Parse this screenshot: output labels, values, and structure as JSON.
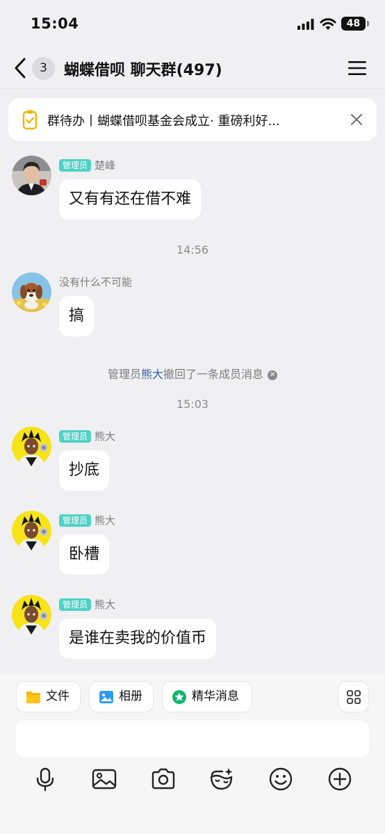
{
  "status_bar": {
    "time": "15:04",
    "battery": "48"
  },
  "header": {
    "unread_count": "3",
    "title": "蝴蝶借呗 聊天群(497)"
  },
  "todo_banner": {
    "text": "群待办丨蝴蝶借呗基金会成立·  重磅利好..."
  },
  "messages": [
    {
      "role_tag": "管理员",
      "sender": "楚峰",
      "text": "又有有还在借不难"
    },
    {
      "timestamp": "14:56"
    },
    {
      "sender": "没有什么不可能",
      "text": "搞"
    },
    {
      "system_prefix": "管理员",
      "system_name": "熊大",
      "system_suffix": "撤回了一条成员消息"
    },
    {
      "timestamp": "15:03"
    },
    {
      "role_tag": "管理员",
      "sender": "熊大",
      "text": "抄底"
    },
    {
      "role_tag": "管理员",
      "sender": "熊大",
      "text": "卧槽"
    },
    {
      "role_tag": "管理员",
      "sender": "熊大",
      "text": "是谁在卖我的价值币"
    }
  ],
  "quick_actions": [
    {
      "label": "文件",
      "icon": "folder-icon"
    },
    {
      "label": "相册",
      "icon": "image-icon"
    },
    {
      "label": "精华消息",
      "icon": "star-badge-icon"
    }
  ],
  "input": {
    "placeholder": "",
    "value": ""
  },
  "toolbar_icons": [
    "microphone-icon",
    "gallery-icon",
    "camera-icon",
    "sticker-icon",
    "emoji-icon",
    "plus-icon"
  ],
  "colors": {
    "admin_tag": "#4fd2c6",
    "highlight_name": "#2d5fa8",
    "background": "#f0f0f2"
  }
}
